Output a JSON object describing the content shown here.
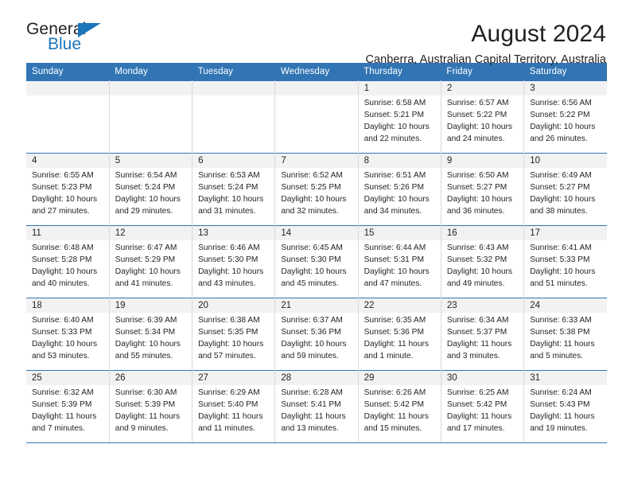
{
  "brand": {
    "name_top": "General",
    "name_bottom": "Blue",
    "triangle_color": "#1b75bb"
  },
  "header": {
    "title": "August 2024",
    "subtitle": "Canberra, Australian Capital Territory, Australia"
  },
  "colors": {
    "header_blue": "#3175b4",
    "daynum_band": "#f2f2f2",
    "text": "#231f20",
    "brand_blue": "#1b75bb"
  },
  "labels": {
    "sunrise_prefix": "Sunrise:",
    "sunset_prefix": "Sunset:",
    "daylight_prefix": "Daylight:"
  },
  "weekdays": [
    "Sunday",
    "Monday",
    "Tuesday",
    "Wednesday",
    "Thursday",
    "Friday",
    "Saturday"
  ],
  "weeks": [
    [
      {
        "day": "",
        "lines": [
          "",
          "",
          "",
          ""
        ]
      },
      {
        "day": "",
        "lines": [
          "",
          "",
          "",
          ""
        ]
      },
      {
        "day": "",
        "lines": [
          "",
          "",
          "",
          ""
        ]
      },
      {
        "day": "",
        "lines": [
          "",
          "",
          "",
          ""
        ]
      },
      {
        "day": "1",
        "lines": [
          "Sunrise: 6:58 AM",
          "Sunset: 5:21 PM",
          "Daylight: 10 hours",
          "and 22 minutes."
        ]
      },
      {
        "day": "2",
        "lines": [
          "Sunrise: 6:57 AM",
          "Sunset: 5:22 PM",
          "Daylight: 10 hours",
          "and 24 minutes."
        ]
      },
      {
        "day": "3",
        "lines": [
          "Sunrise: 6:56 AM",
          "Sunset: 5:22 PM",
          "Daylight: 10 hours",
          "and 26 minutes."
        ]
      }
    ],
    [
      {
        "day": "4",
        "lines": [
          "Sunrise: 6:55 AM",
          "Sunset: 5:23 PM",
          "Daylight: 10 hours",
          "and 27 minutes."
        ]
      },
      {
        "day": "5",
        "lines": [
          "Sunrise: 6:54 AM",
          "Sunset: 5:24 PM",
          "Daylight: 10 hours",
          "and 29 minutes."
        ]
      },
      {
        "day": "6",
        "lines": [
          "Sunrise: 6:53 AM",
          "Sunset: 5:24 PM",
          "Daylight: 10 hours",
          "and 31 minutes."
        ]
      },
      {
        "day": "7",
        "lines": [
          "Sunrise: 6:52 AM",
          "Sunset: 5:25 PM",
          "Daylight: 10 hours",
          "and 32 minutes."
        ]
      },
      {
        "day": "8",
        "lines": [
          "Sunrise: 6:51 AM",
          "Sunset: 5:26 PM",
          "Daylight: 10 hours",
          "and 34 minutes."
        ]
      },
      {
        "day": "9",
        "lines": [
          "Sunrise: 6:50 AM",
          "Sunset: 5:27 PM",
          "Daylight: 10 hours",
          "and 36 minutes."
        ]
      },
      {
        "day": "10",
        "lines": [
          "Sunrise: 6:49 AM",
          "Sunset: 5:27 PM",
          "Daylight: 10 hours",
          "and 38 minutes."
        ]
      }
    ],
    [
      {
        "day": "11",
        "lines": [
          "Sunrise: 6:48 AM",
          "Sunset: 5:28 PM",
          "Daylight: 10 hours",
          "and 40 minutes."
        ]
      },
      {
        "day": "12",
        "lines": [
          "Sunrise: 6:47 AM",
          "Sunset: 5:29 PM",
          "Daylight: 10 hours",
          "and 41 minutes."
        ]
      },
      {
        "day": "13",
        "lines": [
          "Sunrise: 6:46 AM",
          "Sunset: 5:30 PM",
          "Daylight: 10 hours",
          "and 43 minutes."
        ]
      },
      {
        "day": "14",
        "lines": [
          "Sunrise: 6:45 AM",
          "Sunset: 5:30 PM",
          "Daylight: 10 hours",
          "and 45 minutes."
        ]
      },
      {
        "day": "15",
        "lines": [
          "Sunrise: 6:44 AM",
          "Sunset: 5:31 PM",
          "Daylight: 10 hours",
          "and 47 minutes."
        ]
      },
      {
        "day": "16",
        "lines": [
          "Sunrise: 6:43 AM",
          "Sunset: 5:32 PM",
          "Daylight: 10 hours",
          "and 49 minutes."
        ]
      },
      {
        "day": "17",
        "lines": [
          "Sunrise: 6:41 AM",
          "Sunset: 5:33 PM",
          "Daylight: 10 hours",
          "and 51 minutes."
        ]
      }
    ],
    [
      {
        "day": "18",
        "lines": [
          "Sunrise: 6:40 AM",
          "Sunset: 5:33 PM",
          "Daylight: 10 hours",
          "and 53 minutes."
        ]
      },
      {
        "day": "19",
        "lines": [
          "Sunrise: 6:39 AM",
          "Sunset: 5:34 PM",
          "Daylight: 10 hours",
          "and 55 minutes."
        ]
      },
      {
        "day": "20",
        "lines": [
          "Sunrise: 6:38 AM",
          "Sunset: 5:35 PM",
          "Daylight: 10 hours",
          "and 57 minutes."
        ]
      },
      {
        "day": "21",
        "lines": [
          "Sunrise: 6:37 AM",
          "Sunset: 5:36 PM",
          "Daylight: 10 hours",
          "and 59 minutes."
        ]
      },
      {
        "day": "22",
        "lines": [
          "Sunrise: 6:35 AM",
          "Sunset: 5:36 PM",
          "Daylight: 11 hours",
          "and 1 minute."
        ]
      },
      {
        "day": "23",
        "lines": [
          "Sunrise: 6:34 AM",
          "Sunset: 5:37 PM",
          "Daylight: 11 hours",
          "and 3 minutes."
        ]
      },
      {
        "day": "24",
        "lines": [
          "Sunrise: 6:33 AM",
          "Sunset: 5:38 PM",
          "Daylight: 11 hours",
          "and 5 minutes."
        ]
      }
    ],
    [
      {
        "day": "25",
        "lines": [
          "Sunrise: 6:32 AM",
          "Sunset: 5:39 PM",
          "Daylight: 11 hours",
          "and 7 minutes."
        ]
      },
      {
        "day": "26",
        "lines": [
          "Sunrise: 6:30 AM",
          "Sunset: 5:39 PM",
          "Daylight: 11 hours",
          "and 9 minutes."
        ]
      },
      {
        "day": "27",
        "lines": [
          "Sunrise: 6:29 AM",
          "Sunset: 5:40 PM",
          "Daylight: 11 hours",
          "and 11 minutes."
        ]
      },
      {
        "day": "28",
        "lines": [
          "Sunrise: 6:28 AM",
          "Sunset: 5:41 PM",
          "Daylight: 11 hours",
          "and 13 minutes."
        ]
      },
      {
        "day": "29",
        "lines": [
          "Sunrise: 6:26 AM",
          "Sunset: 5:42 PM",
          "Daylight: 11 hours",
          "and 15 minutes."
        ]
      },
      {
        "day": "30",
        "lines": [
          "Sunrise: 6:25 AM",
          "Sunset: 5:42 PM",
          "Daylight: 11 hours",
          "and 17 minutes."
        ]
      },
      {
        "day": "31",
        "lines": [
          "Sunrise: 6:24 AM",
          "Sunset: 5:43 PM",
          "Daylight: 11 hours",
          "and 19 minutes."
        ]
      }
    ]
  ]
}
